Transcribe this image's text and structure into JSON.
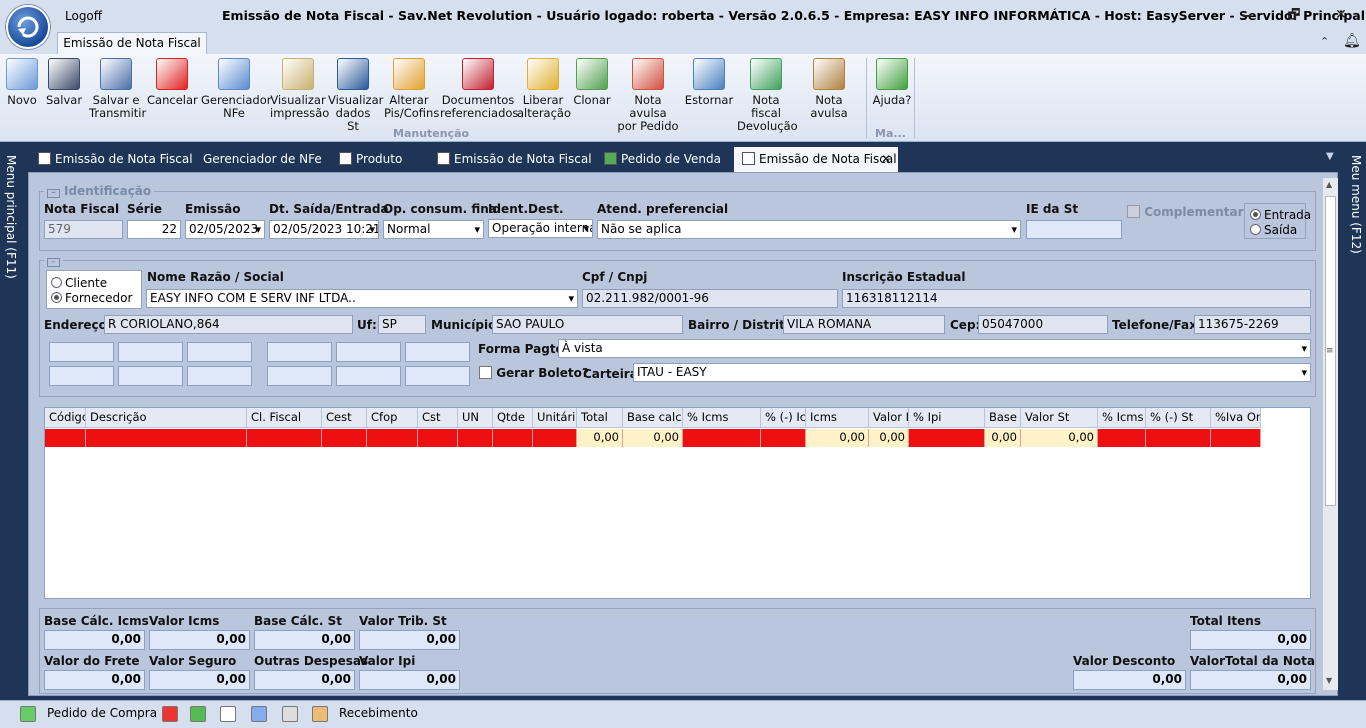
{
  "window": {
    "logoff": "Logoff",
    "title": "Emissão de Nota Fiscal - Sav.Net Revolution - Usuário logado: roberta - Versão 2.0.6.5 - Empresa: EASY INFO INFORMÁTICA - Host: EasyServer - Servidor Principal:[SIM]",
    "minimize": "🗕",
    "restore": "🗗",
    "close": "✕"
  },
  "ribbon": {
    "tab": "Emissão de Nota Fiscal",
    "buttons": [
      {
        "line1": "Novo",
        "line2": "",
        "icon": "new-doc-icon",
        "color": "#6a9ad8"
      },
      {
        "line1": "Salvar",
        "line2": "",
        "icon": "floppy-icon",
        "color": "#3a4a6a"
      },
      {
        "line1": "Salvar e",
        "line2": "Transmitir",
        "icon": "save-transmit-icon",
        "color": "#4a6fa8"
      },
      {
        "line1": "Cancelar",
        "line2": "",
        "icon": "cancel-icon",
        "color": "#e02020"
      },
      {
        "line1": "Gerenciador",
        "line2": "NFe",
        "icon": "nfe-icon",
        "color": "#5a8ad0"
      },
      {
        "line1": "Visualizar",
        "line2": "impressão",
        "icon": "print-preview-icon",
        "color": "#c9b070"
      },
      {
        "line1": "Visualizar",
        "line2": "dados St",
        "icon": "calculator-icon",
        "color": "#2a5a9a"
      },
      {
        "line1": "Alterar",
        "line2": "Pis/Cofins",
        "icon": "edit-pencil-icon",
        "color": "#e0a030"
      },
      {
        "line1": "Documentos",
        "line2": "referenciados",
        "icon": "documents-arrow-icon",
        "color": "#c02030"
      },
      {
        "line1": "Liberar",
        "line2": "alteração",
        "icon": "padlock-icon",
        "color": "#e0b030"
      },
      {
        "line1": "Clonar",
        "line2": "",
        "icon": "clone-icon",
        "color": "#50a050"
      },
      {
        "line1": "Nota avulsa",
        "line2": "por Pedido",
        "icon": "dollar-doc-icon",
        "color": "#d05040"
      },
      {
        "line1": "Estornar",
        "line2": "",
        "icon": "reverse-icon",
        "color": "#4a80c0"
      },
      {
        "line1": "Nota fiscal",
        "line2": "Devolução",
        "icon": "return-icon",
        "color": "#40a060"
      },
      {
        "line1": "Nota avulsa",
        "line2": "",
        "icon": "clipboard-icon",
        "color": "#b08040"
      },
      {
        "line1": "Ajuda?",
        "line2": "",
        "icon": "help-book-icon",
        "color": "#40a040"
      }
    ],
    "group_manutencao": "Manutenção",
    "group_ma": "Ma..."
  },
  "doc_tabs": [
    {
      "label": "Emissão de Nota Fiscal"
    },
    {
      "label": "Gerenciador de NFe"
    },
    {
      "label": "Produto"
    },
    {
      "label": "Emissão de Nota Fiscal"
    },
    {
      "label": "Pedido de Venda"
    },
    {
      "label": "Emissão de Nota Fiscal",
      "active": true
    }
  ],
  "side": {
    "left": "Menu principal (F11)",
    "right": "Meu menu (F12)"
  },
  "ident": {
    "section": "Identificação",
    "nota_fiscal_label": "Nota Fiscal",
    "nota_fiscal": "579",
    "serie_label": "Série",
    "serie": "22",
    "emissao_label": "Emissão",
    "emissao": "02/05/2023",
    "dt_saida_label": "Dt. Saída/Entrada",
    "dt_saida": "02/05/2023 10:21",
    "op_consum_label": "Op. consum. final",
    "op_consum": "Normal",
    "ident_dest_label": "Ident.Dest.",
    "ident_dest": "Operação interna",
    "atend_label": "Atend. preferencial",
    "atend": "Não se aplica",
    "ie_st_label": "IE da St",
    "ie_st": "",
    "complementar": "Complementar",
    "entrada": "Entrada",
    "saida": "Saída"
  },
  "dest": {
    "cliente": "Cliente",
    "fornecedor": "Fornecedor",
    "nome_label": "Nome Razão / Social",
    "nome": "EASY INFO COM E SERV INF LTDA..",
    "cpf_label": "Cpf / Cnpj",
    "cpf": "02.211.982/0001-96",
    "ie_label": "Inscrição Estadual",
    "ie": "116318112114",
    "endereco_label": "Endereço:",
    "endereco": "R CORIOLANO,864",
    "uf_label": "Uf:",
    "uf": "SP",
    "municipio_label": "Município:",
    "municipio": "SAO PAULO",
    "bairro_label": "Bairro / Distrito:",
    "bairro": "VILA ROMANA",
    "cep_label": "Cep:",
    "cep": "05047000",
    "telefone_label": "Telefone/Fax:",
    "telefone": "113675-2269",
    "forma_pagto_label": "Forma Pagto:",
    "forma_pagto": "À vista",
    "gerar_boleto": "Gerar Boleto?",
    "carteira_label": "Carteira:",
    "carteira": "ITAU - EASY"
  },
  "grid": {
    "columns": [
      "Código",
      "Descrição",
      "Cl. Fiscal",
      "Cest",
      "Cfop",
      "Cst",
      "UN",
      "Qtde",
      "Unitário",
      "Total",
      "Base calc. I...",
      "% Icms",
      "% (-) Icms",
      "Icms",
      "Valor Ipi",
      "% Ipi",
      "Base Calc. St",
      "Valor St",
      "% Icms St",
      "% (-) St",
      "%Iva Original"
    ],
    "row": [
      "",
      "",
      "",
      "",
      "",
      "",
      "",
      "",
      "",
      "0,00",
      "0,00",
      "",
      "",
      "0,00",
      "0,00",
      "",
      "0,00",
      "0,00",
      "",
      "",
      ""
    ]
  },
  "totals": {
    "base_icms_label": "Base Cálc. Icms",
    "base_icms": "0,00",
    "valor_icms_label": "Valor Icms",
    "valor_icms": "0,00",
    "base_st_label": "Base Cálc. St",
    "base_st": "0,00",
    "valor_trib_st_label": "Valor Trib. St",
    "valor_trib_st": "0,00",
    "total_itens_label": "Total Itens",
    "total_itens": "0,00",
    "frete_label": "Valor do Frete",
    "frete": "0,00",
    "seguro_label": "Valor Seguro",
    "seguro": "0,00",
    "outras_label": "Outras Despesas",
    "outras": "0,00",
    "ipi_label": "Valor Ipi",
    "ipi": "0,00",
    "desconto_label": "Valor Desconto",
    "desconto": "0,00",
    "total_nota_label": "ValorTotal da Nota",
    "total_nota": "0,00"
  },
  "statusbar": {
    "pedido_compra": "Pedido de Compra",
    "recebimento": "Recebimento"
  }
}
